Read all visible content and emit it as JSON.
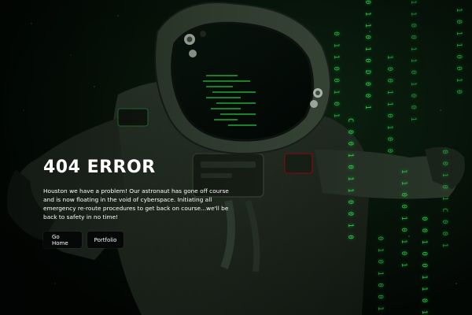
{
  "error": {
    "title": "404 ERROR",
    "message": "Houston we have a problem! Our astronaut has gone off course and is now floating in the void of cyberspace. Initiating all emergency re-route procedures to get back on course...we'll be back to safety in no time!"
  },
  "actions": {
    "home_label": "Go Home",
    "portfolio_label": "Portfolio"
  },
  "background": {
    "scene": "astronaut-illustration",
    "matrix_columns": [
      "0 1 1 0 1 0 D 0 0 1",
      "1 0 0 1 1 0 1 0 0",
      "0 1 1 0 0 1 0 1",
      "C 0 0 1 0 1 1 0 0 1 0",
      "1 1 0 0 1 0 1 0 1",
      "0 0 1 0 0 1 1 0 1 0",
      "1 0 1 1 0 0 1 0",
      "0 0 1 0 1 C 0 0 1",
      "1 1 0 0 1 1 0 1 0 0 1",
      "0 1 0 1 0 0 1 1"
    ]
  },
  "colors": {
    "matrix_green": "#2bd94a",
    "background": "#050a06",
    "button_bg": "#060808",
    "text": "#ffffff"
  }
}
